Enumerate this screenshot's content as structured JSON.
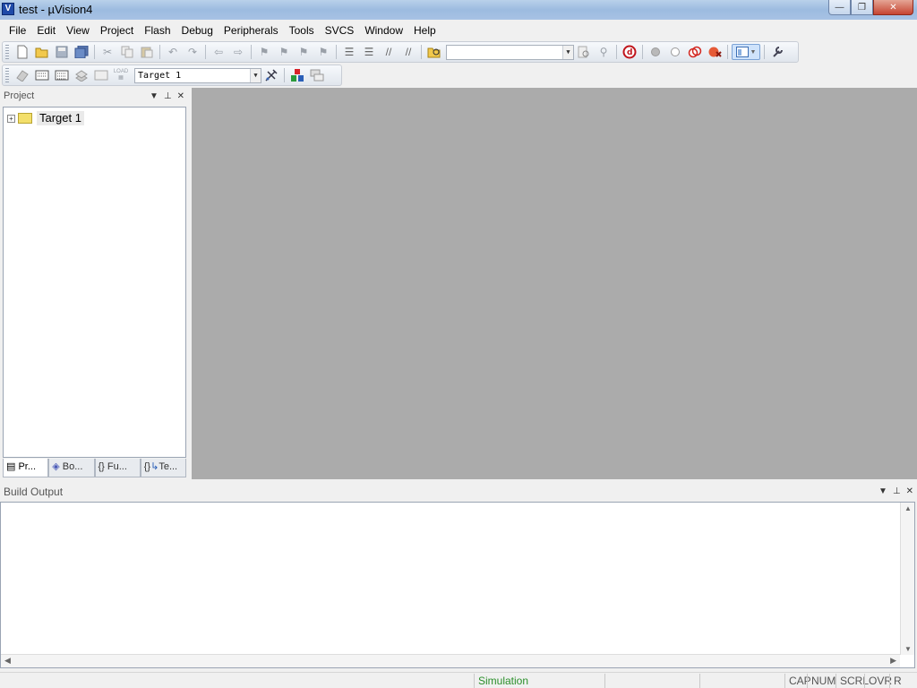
{
  "window": {
    "title": "test  - µVision4",
    "icon": "uvision-icon",
    "minimize_glyph": "—",
    "restore_glyph": "❐",
    "close_glyph": "✕"
  },
  "menu": [
    "File",
    "Edit",
    "View",
    "Project",
    "Flash",
    "Debug",
    "Peripherals",
    "Tools",
    "SVCS",
    "Window",
    "Help"
  ],
  "toolbar1": {
    "find_combo_value": ""
  },
  "toolbar2": {
    "target_select": "Target 1",
    "load_label": "LOAD"
  },
  "project_pane": {
    "title": "Project",
    "tree": [
      {
        "label": "Target 1",
        "expander": "+"
      }
    ],
    "tabs": [
      "Pr...",
      "Bo...",
      "Fu...",
      "Te..."
    ]
  },
  "build_output": {
    "title": "Build Output",
    "content": ""
  },
  "statusbar": {
    "mode": "Simulation",
    "cap": "CAP",
    "num": "NUM",
    "scrl": "SCRL",
    "ovr": "OVR",
    "rw": "R /W"
  },
  "colors": {
    "editor_bg": "#ababab",
    "simulation_text": "#2a8f2a"
  }
}
